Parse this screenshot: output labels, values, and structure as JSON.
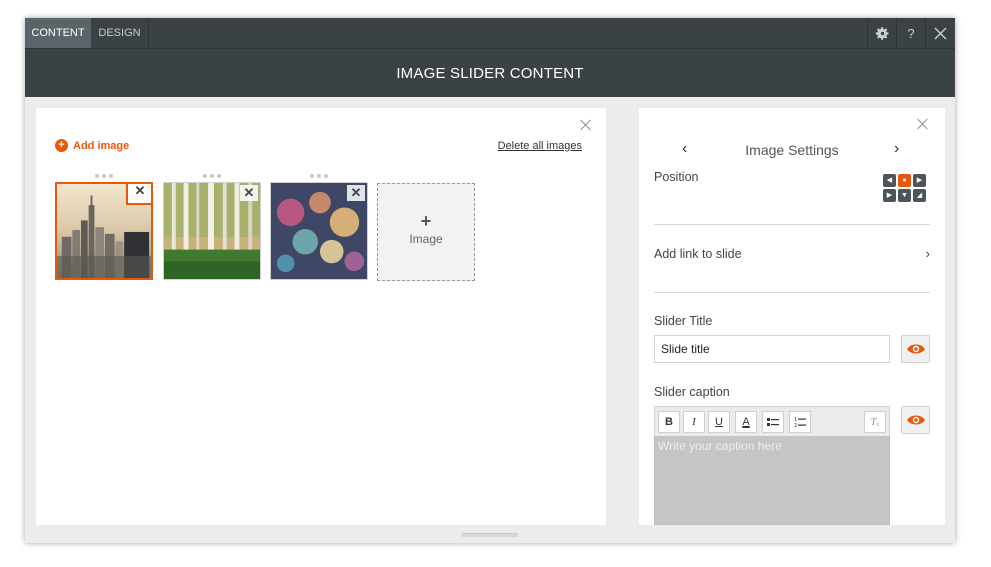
{
  "tabs": [
    {
      "label": "CONTENT",
      "active": true
    },
    {
      "label": "DESIGN",
      "active": false
    }
  ],
  "toolbar_icons": [
    "gear-icon",
    "help-icon",
    "close-icon"
  ],
  "toolbar_help_label": "?",
  "header": {
    "title": "IMAGE SLIDER CONTENT"
  },
  "images_panel": {
    "add_image_label": "Add image",
    "delete_all_label": "Delete all images",
    "thumbnails": [
      {
        "name": "city-skyline",
        "selected": true
      },
      {
        "name": "birch-forest",
        "selected": false
      },
      {
        "name": "bokeh-lights",
        "selected": false
      }
    ],
    "add_tile_label": "Image",
    "add_tile_plus": "+"
  },
  "settings_panel": {
    "title": "Image Settings",
    "prev_arrow": "‹",
    "next_arrow": "›",
    "position_label": "Position",
    "position_selected": "top-center",
    "add_link_label": "Add link to slide",
    "slider_title_label": "Slider Title",
    "slider_title_value": "Slide title",
    "slider_caption_label": "Slider caption",
    "caption_placeholder": "Write your caption here",
    "format_tools": [
      "B",
      "I",
      "U",
      "A",
      "bulleted-list",
      "numbered-list",
      "clear-format"
    ]
  },
  "colors": {
    "accent": "#e8580c",
    "header_bg": "#3a4246",
    "tab_active_bg": "#5b6469"
  }
}
